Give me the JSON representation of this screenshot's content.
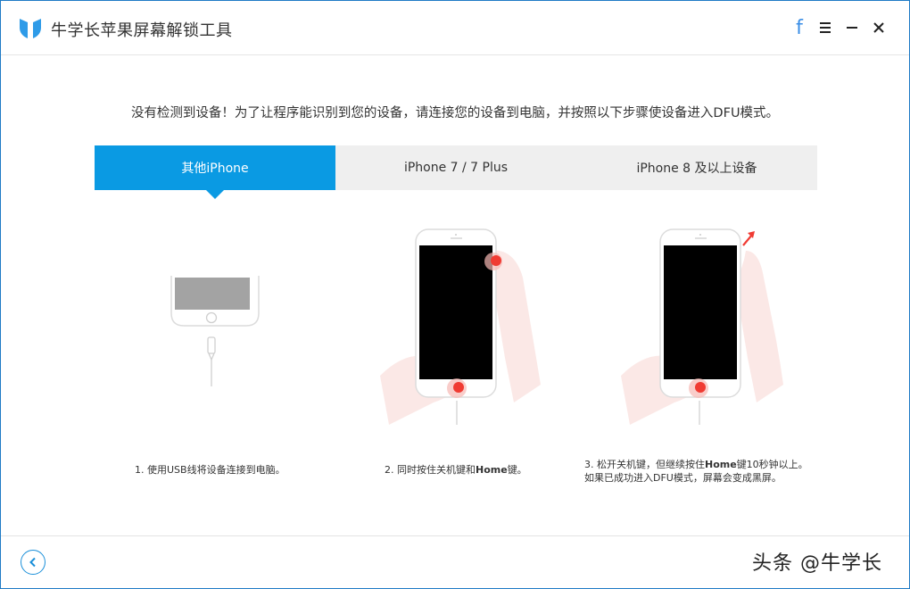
{
  "app": {
    "title": "牛学长苹果屏幕解锁工具",
    "brand_color": "#0a9ae3"
  },
  "titlebar": {
    "facebook_label": "f",
    "menu_icon": "hamburger-icon",
    "minimize_icon": "minimize-icon",
    "close_icon": "close-icon"
  },
  "instruction": "没有检测到设备！为了让程序能识别到您的设备，请连接您的设备到电脑，并按照以下步骤使设备进入DFU模式。",
  "tabs": [
    {
      "label": "其他iPhone",
      "active": true
    },
    {
      "label": "iPhone 7 / 7 Plus",
      "active": false
    },
    {
      "label": "iPhone 8 及以上设备",
      "active": false
    }
  ],
  "steps": [
    {
      "text_pre": "1. 使用USB线将设备连接到电脑。"
    },
    {
      "text_pre": "2. 同时按住关机键和",
      "bold": "Home",
      "text_post": "键。"
    },
    {
      "line1_pre": "3. 松开关机键，但继续按住",
      "line1_bold": "Home",
      "line1_post": "键10秒钟以上。",
      "line2": "如果已成功进入DFU模式，屏幕会变成黑屏。"
    }
  ],
  "footer": {
    "back_icon": "chevron-left-icon",
    "watermark": "头条 @牛学长"
  }
}
